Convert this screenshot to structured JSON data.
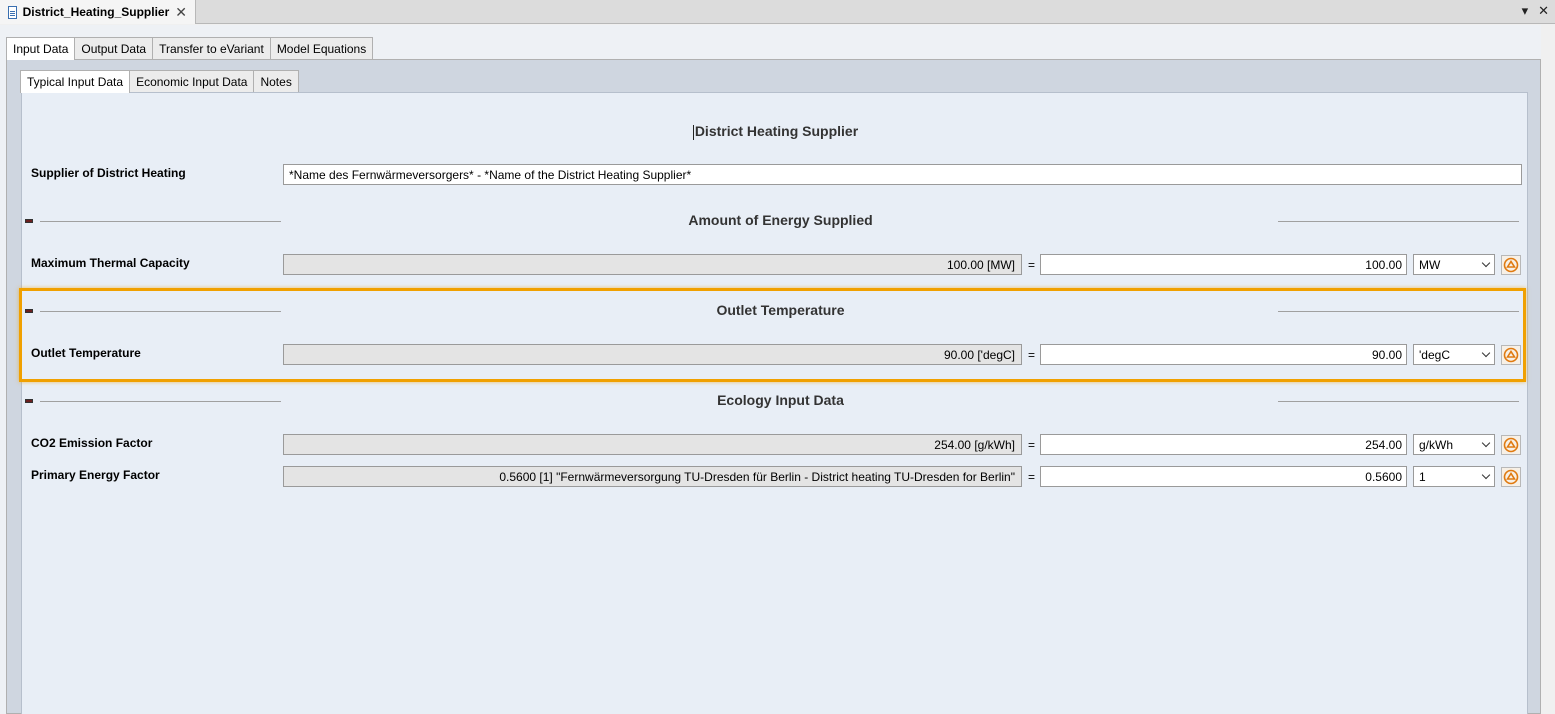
{
  "document_tab": {
    "title": "District_Heating_Supplier",
    "close_glyph": "✕"
  },
  "window_controls": {
    "menu_glyph": "▾",
    "close_glyph": "✕"
  },
  "outer_tabs": [
    {
      "label": "Input Data",
      "active": true
    },
    {
      "label": "Output Data",
      "active": false
    },
    {
      "label": "Transfer to eVariant",
      "active": false
    },
    {
      "label": "Model Equations",
      "active": false
    }
  ],
  "inner_tabs": [
    {
      "label": "Typical Input Data",
      "active": true
    },
    {
      "label": "Economic Input Data",
      "active": false
    },
    {
      "label": "Notes",
      "active": false
    }
  ],
  "main_title": "District Heating Supplier",
  "supplier": {
    "label": "Supplier of District Heating",
    "value": "*Name des Fernwärmeversorgers* - *Name of the District Heating Supplier*"
  },
  "sections": {
    "energy": {
      "title": "Amount of Energy Supplied"
    },
    "outlet": {
      "title": "Outlet Temperature"
    },
    "ecology": {
      "title": "Ecology Input Data"
    }
  },
  "rows": {
    "max_capacity": {
      "label": "Maximum Thermal Capacity",
      "computed": "100.00 [MW]",
      "equals": "=",
      "value": "100.00",
      "unit": "MW"
    },
    "outlet_temp": {
      "label": "Outlet Temperature",
      "computed": "90.00 ['degC]",
      "equals": "=",
      "value": "90.00",
      "unit": "'degC"
    },
    "co2": {
      "label": "CO2 Emission Factor",
      "computed": "254.00 [g/kWh]",
      "equals": "=",
      "value": "254.00",
      "unit": "g/kWh"
    },
    "primary_energy": {
      "label": "Primary Energy Factor",
      "computed": "0.5600 [1] \"Fernwärmeversorgung TU-Dresden für Berlin - District heating TU-Dresden for Berlin\"",
      "equals": "=",
      "value": "0.5600",
      "unit": "1"
    }
  },
  "colors": {
    "highlight": "#f0a000",
    "panel_bg": "#e8eef6",
    "accent_icon": "#e07a10"
  },
  "icons": {
    "action_button": "link-source-icon",
    "doc": "document-icon"
  }
}
